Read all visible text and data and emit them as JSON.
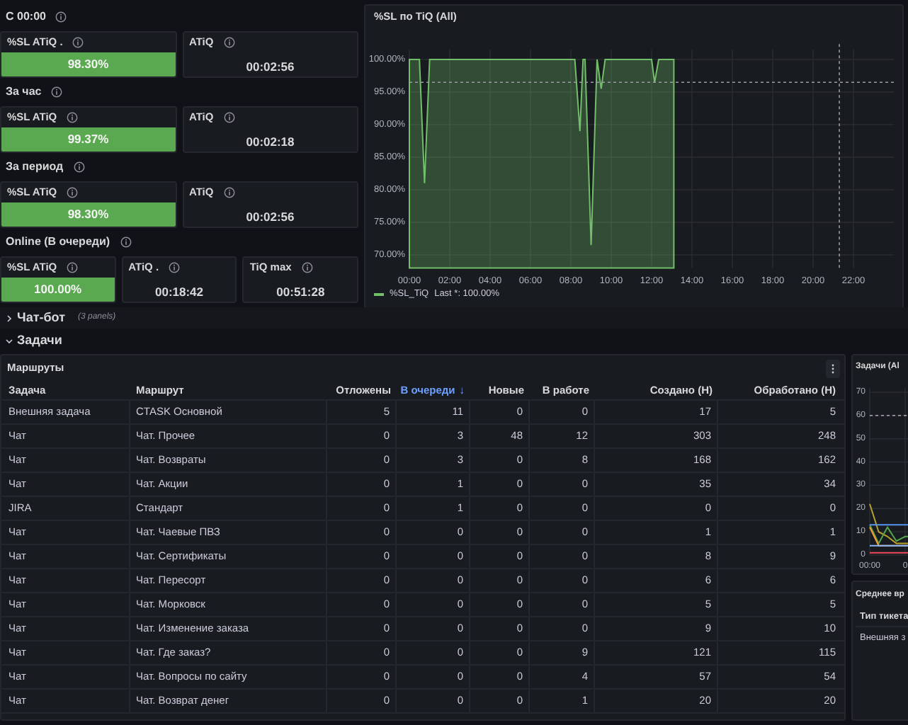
{
  "stat_groups": [
    {
      "title": "С 00:00",
      "stats": [
        {
          "title": "%SL ATiQ .",
          "value": "98.30%",
          "kind": "colored"
        },
        {
          "title": "ATiQ",
          "value": "00:02:56",
          "kind": "plain"
        }
      ]
    },
    {
      "title": "За час",
      "stats": [
        {
          "title": "%SL ATiQ",
          "value": "99.37%",
          "kind": "colored"
        },
        {
          "title": "ATiQ",
          "value": "00:02:18",
          "kind": "plain"
        }
      ]
    },
    {
      "title": "За период",
      "stats": [
        {
          "title": "%SL ATiQ",
          "value": "98.30%",
          "kind": "colored"
        },
        {
          "title": "ATiQ",
          "value": "00:02:56",
          "kind": "plain"
        }
      ]
    },
    {
      "title": "Online (В очереди)",
      "stats": [
        {
          "title": "%SL ATiQ",
          "value": "100.00%",
          "kind": "colored"
        },
        {
          "title": "ATiQ .",
          "value": "00:18:42",
          "kind": "plain"
        },
        {
          "title": "TiQ max",
          "value": "00:51:28",
          "kind": "plain"
        }
      ]
    }
  ],
  "sl_chart": {
    "title": "%SL по TiQ (All)",
    "legend_value": "Last *: 100.00%",
    "chart_data": {
      "type": "area",
      "x": [
        0,
        0.5,
        0.75,
        1,
        8.2,
        8.45,
        8.6,
        8.7,
        9.0,
        9.3,
        9.5,
        9.7,
        12.0,
        12.15,
        12.35,
        13.1
      ],
      "series": [
        {
          "name": "%SL_TiQ",
          "color": "#73bf69",
          "values": [
            100,
            100,
            81,
            100,
            100,
            89,
            100,
            100,
            71.5,
            100,
            95.5,
            100,
            100,
            96.5,
            100,
            100
          ]
        }
      ],
      "xlim": [
        0,
        24
      ],
      "ylim": [
        68,
        101.5
      ],
      "xticks": [
        {
          "value": 0,
          "label": "00:00"
        },
        {
          "value": 2,
          "label": "02:00"
        },
        {
          "value": 4,
          "label": "04:00"
        },
        {
          "value": 6,
          "label": "06:00"
        },
        {
          "value": 8,
          "label": "08:00"
        },
        {
          "value": 10,
          "label": "10:00"
        },
        {
          "value": 12,
          "label": "12:00"
        },
        {
          "value": 14,
          "label": "14:00"
        },
        {
          "value": 16,
          "label": "16:00"
        },
        {
          "value": 18,
          "label": "18:00"
        },
        {
          "value": 20,
          "label": "20:00"
        },
        {
          "value": 22,
          "label": "22:00"
        }
      ],
      "yticks": [
        {
          "value": 70,
          "label": "70.00%"
        },
        {
          "value": 75,
          "label": "75.00%"
        },
        {
          "value": 80,
          "label": "80.00%"
        },
        {
          "value": 85,
          "label": "85.00%"
        },
        {
          "value": 90,
          "label": "90.00%"
        },
        {
          "value": 95,
          "label": "95.00%"
        },
        {
          "value": 100,
          "label": "100.00%"
        }
      ],
      "grid": true,
      "ref_lines": [
        {
          "axis": "y",
          "value": 96.5
        },
        {
          "axis": "x",
          "value": 21.3
        }
      ]
    }
  },
  "row_headers": [
    {
      "title": "Чат-бот",
      "note": "(3 panels)",
      "expanded": false
    },
    {
      "title": "Задачи",
      "expanded": true
    }
  ],
  "routes_table": {
    "title": "Маршруты",
    "columns": [
      {
        "label": "Задача"
      },
      {
        "label": "Маршрут"
      },
      {
        "label": "Отложены"
      },
      {
        "label": "В очереди",
        "sort": "↓"
      },
      {
        "label": "Новые"
      },
      {
        "label": "В работе"
      },
      {
        "label": "Создано (H)"
      },
      {
        "label": "Обработано (H)"
      }
    ],
    "rows": [
      [
        "Внешняя задача",
        "CTASK Основной",
        "5",
        "11",
        "0",
        "0",
        "17",
        "5"
      ],
      [
        "Чат",
        "Чат. Прочее",
        "0",
        "3",
        "48",
        "12",
        "303",
        "248"
      ],
      [
        "Чат",
        "Чат. Возвраты",
        "0",
        "3",
        "0",
        "8",
        "168",
        "162"
      ],
      [
        "Чат",
        "Чат. Акции",
        "0",
        "1",
        "0",
        "0",
        "35",
        "34"
      ],
      [
        "JIRA",
        "Стандарт",
        "0",
        "1",
        "0",
        "0",
        "0",
        "0"
      ],
      [
        "Чат",
        "Чат. Чаевые ПВЗ",
        "0",
        "0",
        "0",
        "0",
        "1",
        "1"
      ],
      [
        "Чат",
        "Чат. Сертификаты",
        "0",
        "0",
        "0",
        "0",
        "8",
        "9"
      ],
      [
        "Чат",
        "Чат. Пересорт",
        "0",
        "0",
        "0",
        "0",
        "6",
        "6"
      ],
      [
        "Чат",
        "Чат. Морковск",
        "0",
        "0",
        "0",
        "0",
        "5",
        "5"
      ],
      [
        "Чат",
        "Чат. Изменение заказа",
        "0",
        "0",
        "0",
        "0",
        "9",
        "10"
      ],
      [
        "Чат",
        "Чат. Где заказ?",
        "0",
        "0",
        "0",
        "9",
        "121",
        "115"
      ],
      [
        "Чат",
        "Чат. Вопросы по сайту",
        "0",
        "0",
        "0",
        "4",
        "57",
        "54"
      ],
      [
        "Чат",
        "Чат. Возврат денег",
        "0",
        "0",
        "0",
        "1",
        "20",
        "20"
      ]
    ]
  },
  "tasks_chart": {
    "title": "Задачи (Al",
    "chart_data": {
      "type": "line",
      "categories": [
        "00:00",
        null,
        null,
        null,
        "0",
        null
      ],
      "series": [
        {
          "color": "#b8a32a",
          "values": [
            22,
            10,
            8,
            5,
            5,
            5
          ]
        },
        {
          "color": "#56a64b",
          "values": [
            13,
            5,
            12,
            6,
            8,
            8
          ]
        },
        {
          "color": "#ff9830",
          "values": [
            12,
            4,
            4,
            4,
            4,
            4
          ]
        },
        {
          "color": "#5794f2",
          "values": [
            13,
            13,
            13,
            13,
            13,
            13
          ]
        },
        {
          "color": "#8ab8ff",
          "values": [
            4,
            4,
            4,
            4,
            4,
            4
          ]
        },
        {
          "color": "#f2495c",
          "values": [
            1,
            1,
            1,
            1,
            1,
            1
          ]
        }
      ],
      "ylim": [
        0,
        72
      ],
      "yticks": [
        0,
        10,
        20,
        30,
        40,
        50,
        60,
        70
      ],
      "grid": true,
      "ref_lines": [
        {
          "axis": "y",
          "value": 60
        }
      ]
    }
  },
  "avg_table": {
    "title": "Среднее вр",
    "columns": [
      "Тип тикета"
    ],
    "rows": [
      [
        "Внешняя з"
      ]
    ]
  }
}
